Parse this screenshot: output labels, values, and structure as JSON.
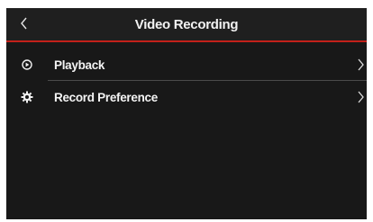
{
  "header": {
    "title": "Video Recording",
    "back_icon": "chevron-left-icon"
  },
  "menu": {
    "items": [
      {
        "label": "Playback",
        "icon": "play-circle-icon",
        "chevron": "chevron-right-icon"
      },
      {
        "label": "Record Preference",
        "icon": "gear-icon",
        "chevron": "chevron-right-icon"
      }
    ]
  },
  "colors": {
    "background": "#181818",
    "header_background": "#1f1f1f",
    "accent": "#c3201a",
    "text": "#f4f4f4",
    "divider": "#4a4a4a"
  }
}
